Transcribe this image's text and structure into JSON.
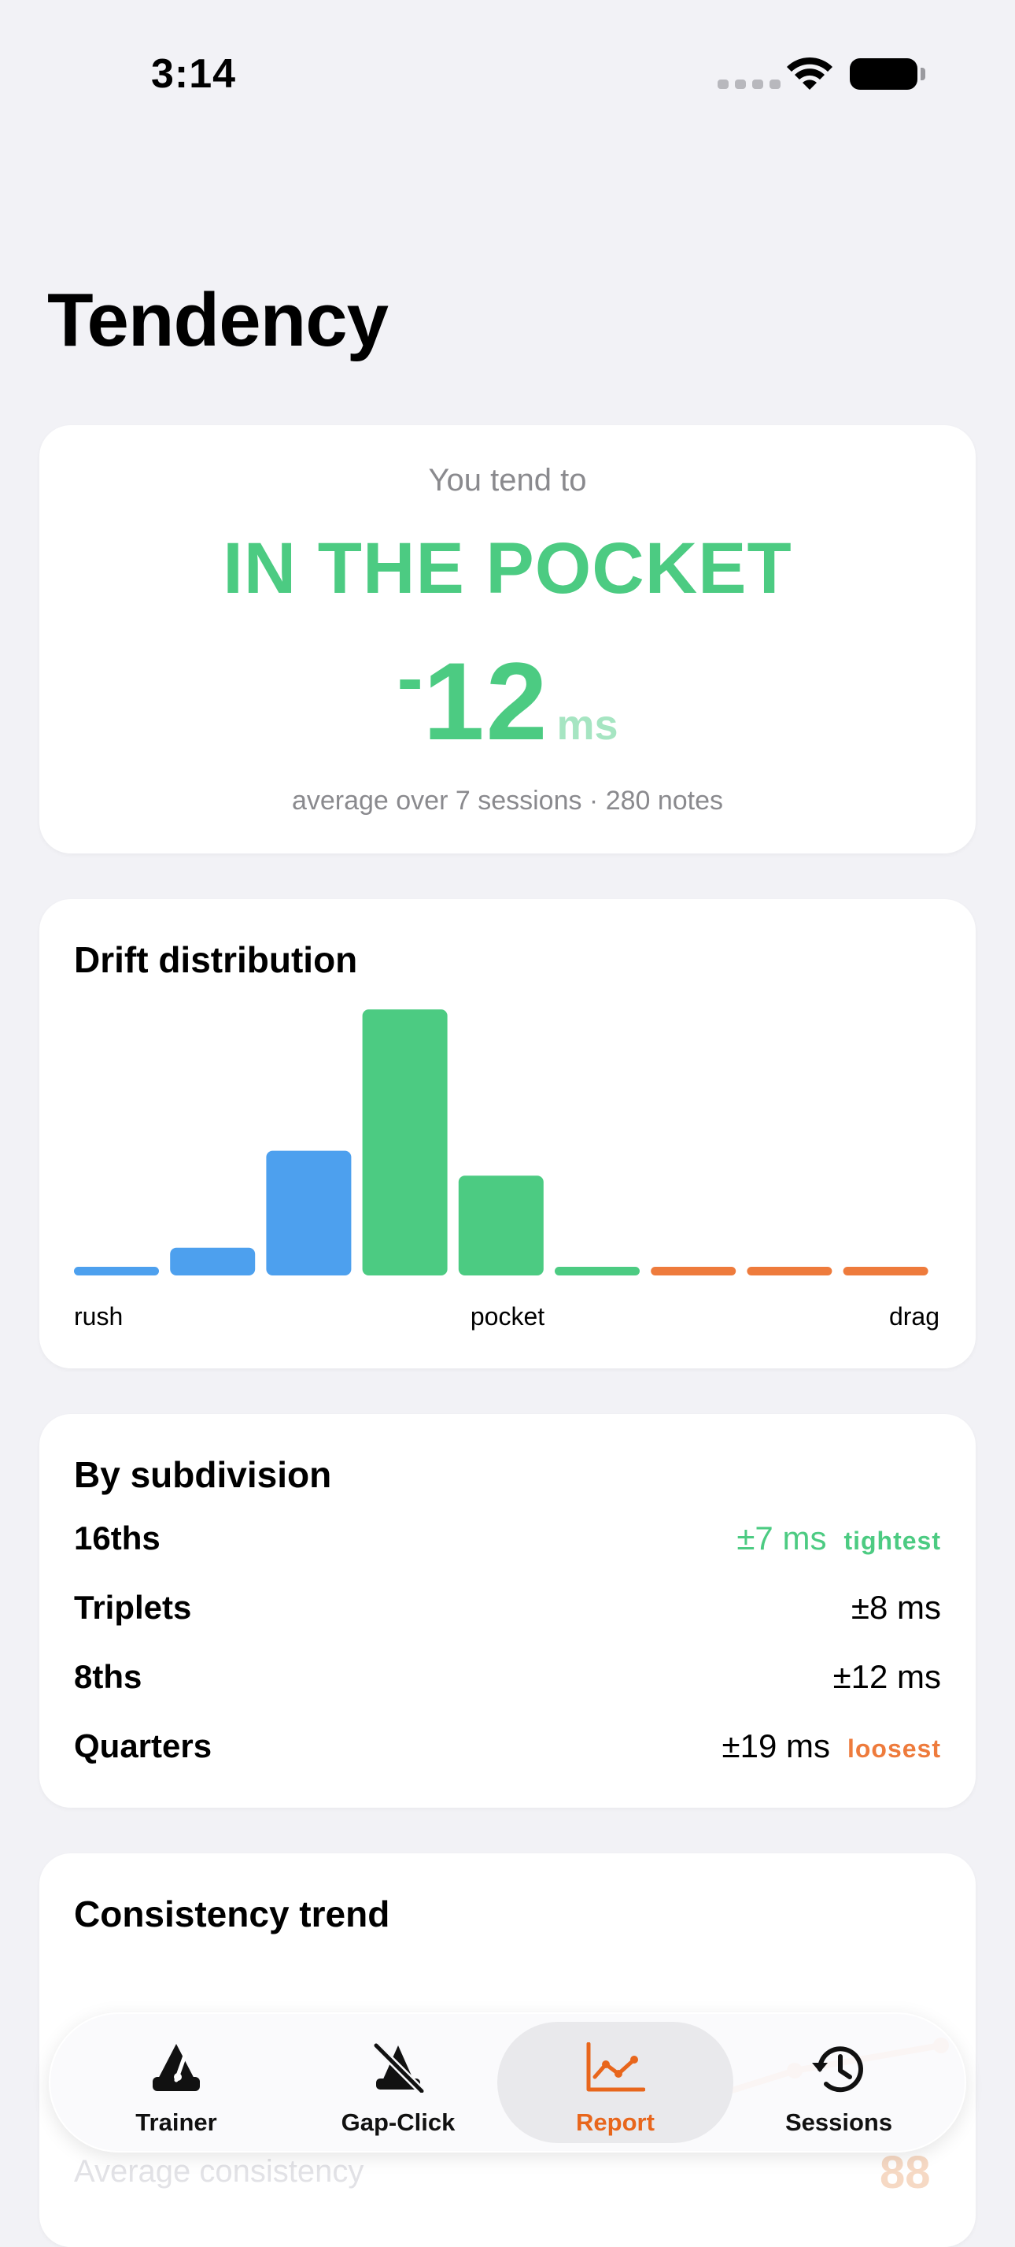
{
  "status_bar": {
    "time": "3:14"
  },
  "page": {
    "title": "Tendency"
  },
  "summary": {
    "lead": "You tend to",
    "verdict": "IN THE POCKET",
    "sign": "-",
    "value": "12",
    "unit": "ms",
    "footnote": "average over 7 sessions · 280 notes"
  },
  "drift": {
    "title": "Drift distribution",
    "labels": {
      "rush": "rush",
      "pocket": "pocket",
      "drag": "drag"
    },
    "colors": {
      "rush": "#4da0ee",
      "pocket": "#4ccb82",
      "drag": "#ee7b3c"
    }
  },
  "chart_data": {
    "type": "bar",
    "title": "Drift distribution",
    "categories": [
      "1",
      "2",
      "3",
      "4",
      "5",
      "6",
      "7",
      "8",
      "9"
    ],
    "values": [
      1,
      10,
      45,
      96,
      36,
      1,
      1,
      1,
      1
    ],
    "zone": [
      "rush",
      "rush",
      "rush",
      "pocket",
      "pocket",
      "pocket",
      "drag",
      "drag",
      "drag"
    ],
    "xlabel": "",
    "ylabel": "",
    "x_tick_labels": [
      "rush",
      "pocket",
      "drag"
    ],
    "ylim": [
      0,
      100
    ]
  },
  "subdivision": {
    "title": "By subdivision",
    "rows": [
      {
        "label": "16ths",
        "value": "±7 ms",
        "tag": "tightest",
        "tone": "green"
      },
      {
        "label": "Triplets",
        "value": "±8 ms",
        "tag": "",
        "tone": ""
      },
      {
        "label": "8ths",
        "value": "±12 ms",
        "tag": "",
        "tone": ""
      },
      {
        "label": "Quarters",
        "value": "±19 ms",
        "tag": "loosest",
        "tone": "orange"
      }
    ]
  },
  "consistency": {
    "title": "Consistency trend",
    "average_label": "Average consistency",
    "average_value": "88"
  },
  "tabs": [
    {
      "label": "Trainer",
      "icon": "metronome-icon",
      "selected": false
    },
    {
      "label": "Gap-Click",
      "icon": "muted-metronome-icon",
      "selected": false
    },
    {
      "label": "Report",
      "icon": "chart-icon",
      "selected": true
    },
    {
      "label": "Sessions",
      "icon": "history-icon",
      "selected": false
    }
  ],
  "colors": {
    "green": "#4ccb82",
    "orange": "#ee7b3c",
    "blue": "#4da0ee"
  }
}
